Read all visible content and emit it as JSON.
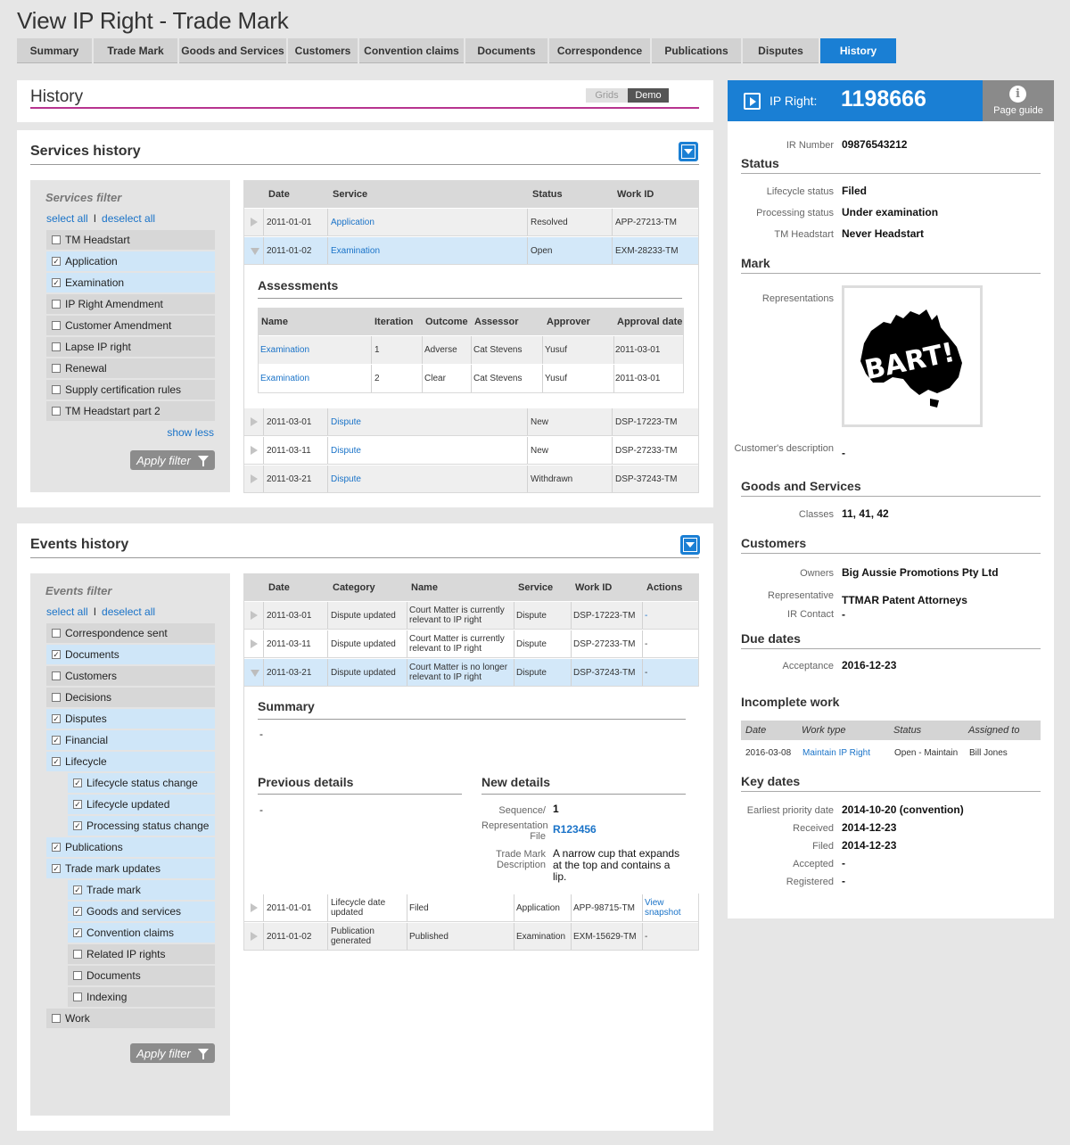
{
  "page_title": "View IP Right - Trade Mark",
  "tabs": [
    "Summary",
    "Trade Mark",
    "Goods and Services",
    "Customers",
    "Convention claims",
    "Documents",
    "Correspondence",
    "Publications",
    "Disputes",
    "History"
  ],
  "history": {
    "title": "History",
    "toggle_grids": "Grids",
    "toggle_demo": "Demo"
  },
  "services": {
    "title": "Services history",
    "filter_title": "Services filter",
    "select_all": "select all",
    "sep": "I",
    "deselect_all": "deselect all",
    "filters": [
      {
        "label": "TM Headstart",
        "checked": false
      },
      {
        "label": "Application",
        "checked": true
      },
      {
        "label": "Examination",
        "checked": true
      },
      {
        "label": "IP Right Amendment",
        "checked": false
      },
      {
        "label": "Customer Amendment",
        "checked": false
      },
      {
        "label": "Lapse IP right",
        "checked": false
      },
      {
        "label": "Renewal",
        "checked": false
      },
      {
        "label": "Supply certification rules",
        "checked": false
      },
      {
        "label": "TM Headstart part 2",
        "checked": false
      }
    ],
    "show_less": "show less",
    "apply": "Apply filter",
    "headers": [
      "Date",
      "Service",
      "Status",
      "Work ID"
    ],
    "rows": [
      {
        "date": "2011-01-01",
        "service": "Application",
        "status": "Resolved",
        "work_id": "APP-27213-TM"
      },
      {
        "date": "2011-01-02",
        "service": "Examination",
        "status": "Open",
        "work_id": "EXM-28233-TM"
      },
      {
        "date": "2011-03-01",
        "service": "Dispute",
        "status": "New",
        "work_id": "DSP-17223-TM"
      },
      {
        "date": "2011-03-11",
        "service": "Dispute",
        "status": "New",
        "work_id": "DSP-27233-TM"
      },
      {
        "date": "2011-03-21",
        "service": "Dispute",
        "status": "Withdrawn",
        "work_id": "DSP-37243-TM"
      }
    ],
    "assessments": {
      "title": "Assessments",
      "headers": [
        "Name",
        "Iteration",
        "Outcome",
        "Assessor",
        "Approver",
        "Approval date"
      ],
      "rows": [
        {
          "name": "Examination",
          "iteration": "1",
          "outcome": "Adverse",
          "assessor": "Cat Stevens",
          "approver": "Yusuf",
          "date": "2011-03-01"
        },
        {
          "name": "Examination",
          "iteration": "2",
          "outcome": "Clear",
          "assessor": "Cat Stevens",
          "approver": "Yusuf",
          "date": "2011-03-01"
        }
      ]
    }
  },
  "events": {
    "title": "Events history",
    "filter_title": "Events filter",
    "select_all": "select all",
    "sep": "I",
    "deselect_all": "deselect all",
    "filters": [
      {
        "label": "Correspondence sent",
        "checked": false,
        "indent": false
      },
      {
        "label": "Documents",
        "checked": true,
        "indent": false
      },
      {
        "label": "Customers",
        "checked": false,
        "indent": false
      },
      {
        "label": "Decisions",
        "checked": false,
        "indent": false
      },
      {
        "label": "Disputes",
        "checked": true,
        "indent": false
      },
      {
        "label": "Financial",
        "checked": true,
        "indent": false
      },
      {
        "label": "Lifecycle",
        "checked": true,
        "indent": false
      },
      {
        "label": "Lifecycle status change",
        "checked": true,
        "indent": true
      },
      {
        "label": "Lifecycle updated",
        "checked": true,
        "indent": true
      },
      {
        "label": "Processing status change",
        "checked": true,
        "indent": true
      },
      {
        "label": "Publications",
        "checked": true,
        "indent": false
      },
      {
        "label": "Trade mark updates",
        "checked": true,
        "indent": false
      },
      {
        "label": "Trade mark",
        "checked": true,
        "indent": true
      },
      {
        "label": "Goods and services",
        "checked": true,
        "indent": true
      },
      {
        "label": "Convention claims",
        "checked": true,
        "indent": true
      },
      {
        "label": "Related IP rights",
        "checked": false,
        "indent": true
      },
      {
        "label": "Documents",
        "checked": false,
        "indent": true
      },
      {
        "label": "Indexing",
        "checked": false,
        "indent": true
      },
      {
        "label": "Work",
        "checked": false,
        "indent": false
      }
    ],
    "apply": "Apply filter",
    "headers": [
      "Date",
      "Category",
      "Name",
      "Service",
      "Work ID",
      "Actions"
    ],
    "rows": [
      {
        "date": "2011-03-01",
        "category": "Dispute updated",
        "name": "Court Matter is currently relevant to IP right",
        "service": "Dispute",
        "work_id": "DSP-17223-TM",
        "action": "-"
      },
      {
        "date": "2011-03-11",
        "category": "Dispute updated",
        "name": "Court Matter is currently relevant to IP right",
        "service": "Dispute",
        "work_id": "DSP-27233-TM",
        "action": "-"
      },
      {
        "date": "2011-03-21",
        "category": "Dispute updated",
        "name": "Court Matter is no longer relevant to IP right",
        "service": "Dispute",
        "work_id": "DSP-37243-TM",
        "action": "-"
      },
      {
        "date": "2011-01-01",
        "category": "Lifecycle date updated",
        "name": "Filed",
        "service": "Application",
        "work_id": "APP-98715-TM",
        "action": "View snapshot"
      },
      {
        "date": "2011-01-02",
        "category": "Publication generated",
        "name": "Published",
        "service": "Examination",
        "work_id": "EXM-15629-TM",
        "action": "-"
      }
    ],
    "detail": {
      "summary_title": "Summary",
      "summary_value": "-",
      "prev_title": "Previous details",
      "prev_value": "-",
      "new_title": "New details",
      "sequence_label": "Sequence/",
      "sequence_value": "1",
      "rep_label": "Representation File",
      "rep_value": "R123456",
      "desc_label": "Trade Mark Description",
      "desc_value": "A narrow cup that expands at the top and contains a lip."
    }
  },
  "sidebar": {
    "ip_right_label": "IP Right:",
    "ip_right_number": "1198666",
    "page_guide": "Page guide",
    "ir_number_label": "IR Number",
    "ir_number": "09876543212",
    "status_title": "Status",
    "lifecycle_label": "Lifecycle status",
    "lifecycle": "Filed",
    "processing_label": "Processing status",
    "processing": "Under examination",
    "headstart_label": "TM Headstart",
    "headstart": "Never Headstart",
    "mark_title": "Mark",
    "representations_label": "Representations",
    "mark_text": "BART!",
    "cust_desc_label": "Customer's description",
    "cust_desc": "-",
    "gs_title": "Goods and Services",
    "classes_label": "Classes",
    "classes": "11, 41, 42",
    "customers_title": "Customers",
    "owners_label": "Owners",
    "owners": "Big Aussie Promotions Pty Ltd",
    "rep_label": "Representative",
    "rep": "TTMAR Patent Attorneys",
    "ircontact_label": "IR Contact",
    "ircontact": "-",
    "due_title": "Due dates",
    "acceptance_label": "Acceptance",
    "acceptance": "2016-12-23",
    "incomplete_title": "Incomplete work",
    "iw_headers": [
      "Date",
      "Work type",
      "Status",
      "Assigned to"
    ],
    "iw_row": {
      "date": "2016-03-08",
      "type": "Maintain IP Right",
      "status": "Open - Maintain",
      "assigned": "Bill Jones"
    },
    "key_title": "Key dates",
    "earliest_label": "Earliest priority date",
    "earliest": "2014-10-20 (convention)",
    "received_label": "Received",
    "received": "2014-12-23",
    "filed_label": "Filed",
    "filed": "2014-12-23",
    "accepted_label": "Accepted",
    "accepted": "-",
    "registered_label": "Registered",
    "registered": "-"
  }
}
